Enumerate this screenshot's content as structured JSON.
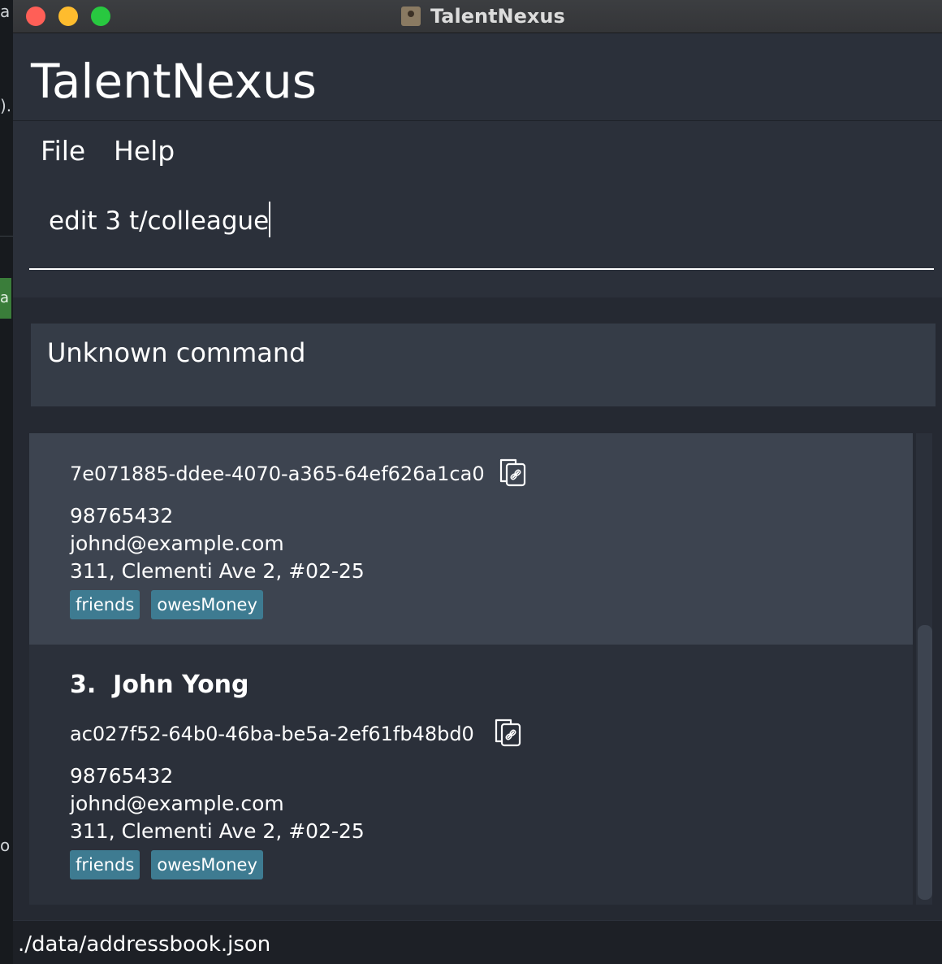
{
  "window": {
    "title": "TalentNexus",
    "colors": {
      "close": "#ff5f57",
      "minimize": "#febc2e",
      "zoom": "#28c840"
    }
  },
  "app": {
    "name": "TalentNexus"
  },
  "menu": {
    "items": [
      "File",
      "Help"
    ]
  },
  "command": {
    "value": "edit 3 t/colleague"
  },
  "result": {
    "message": "Unknown command"
  },
  "persons": [
    {
      "uuid": "7e071885-ddee-4070-a365-64ef626a1ca0",
      "phone": "98765432",
      "email": "johnd@example.com",
      "address": "311, Clementi Ave 2, #02-25",
      "tags": [
        "friends",
        "owesMoney"
      ]
    },
    {
      "index": "3.",
      "name": "John Yong",
      "uuid": "ac027f52-64b0-46ba-be5a-2ef61fb48bd0",
      "phone": "98765432",
      "email": "johnd@example.com",
      "address": "311, Clementi Ave 2, #02-25",
      "tags": [
        "friends",
        "owesMoney"
      ]
    }
  ],
  "status": {
    "file_path": "./data/addressbook.json"
  },
  "icons": {
    "copy": "copy-link-icon"
  },
  "theme": {
    "background": "#2b303a",
    "selected_card": "#3d4450",
    "tag": "#3e7b91"
  }
}
